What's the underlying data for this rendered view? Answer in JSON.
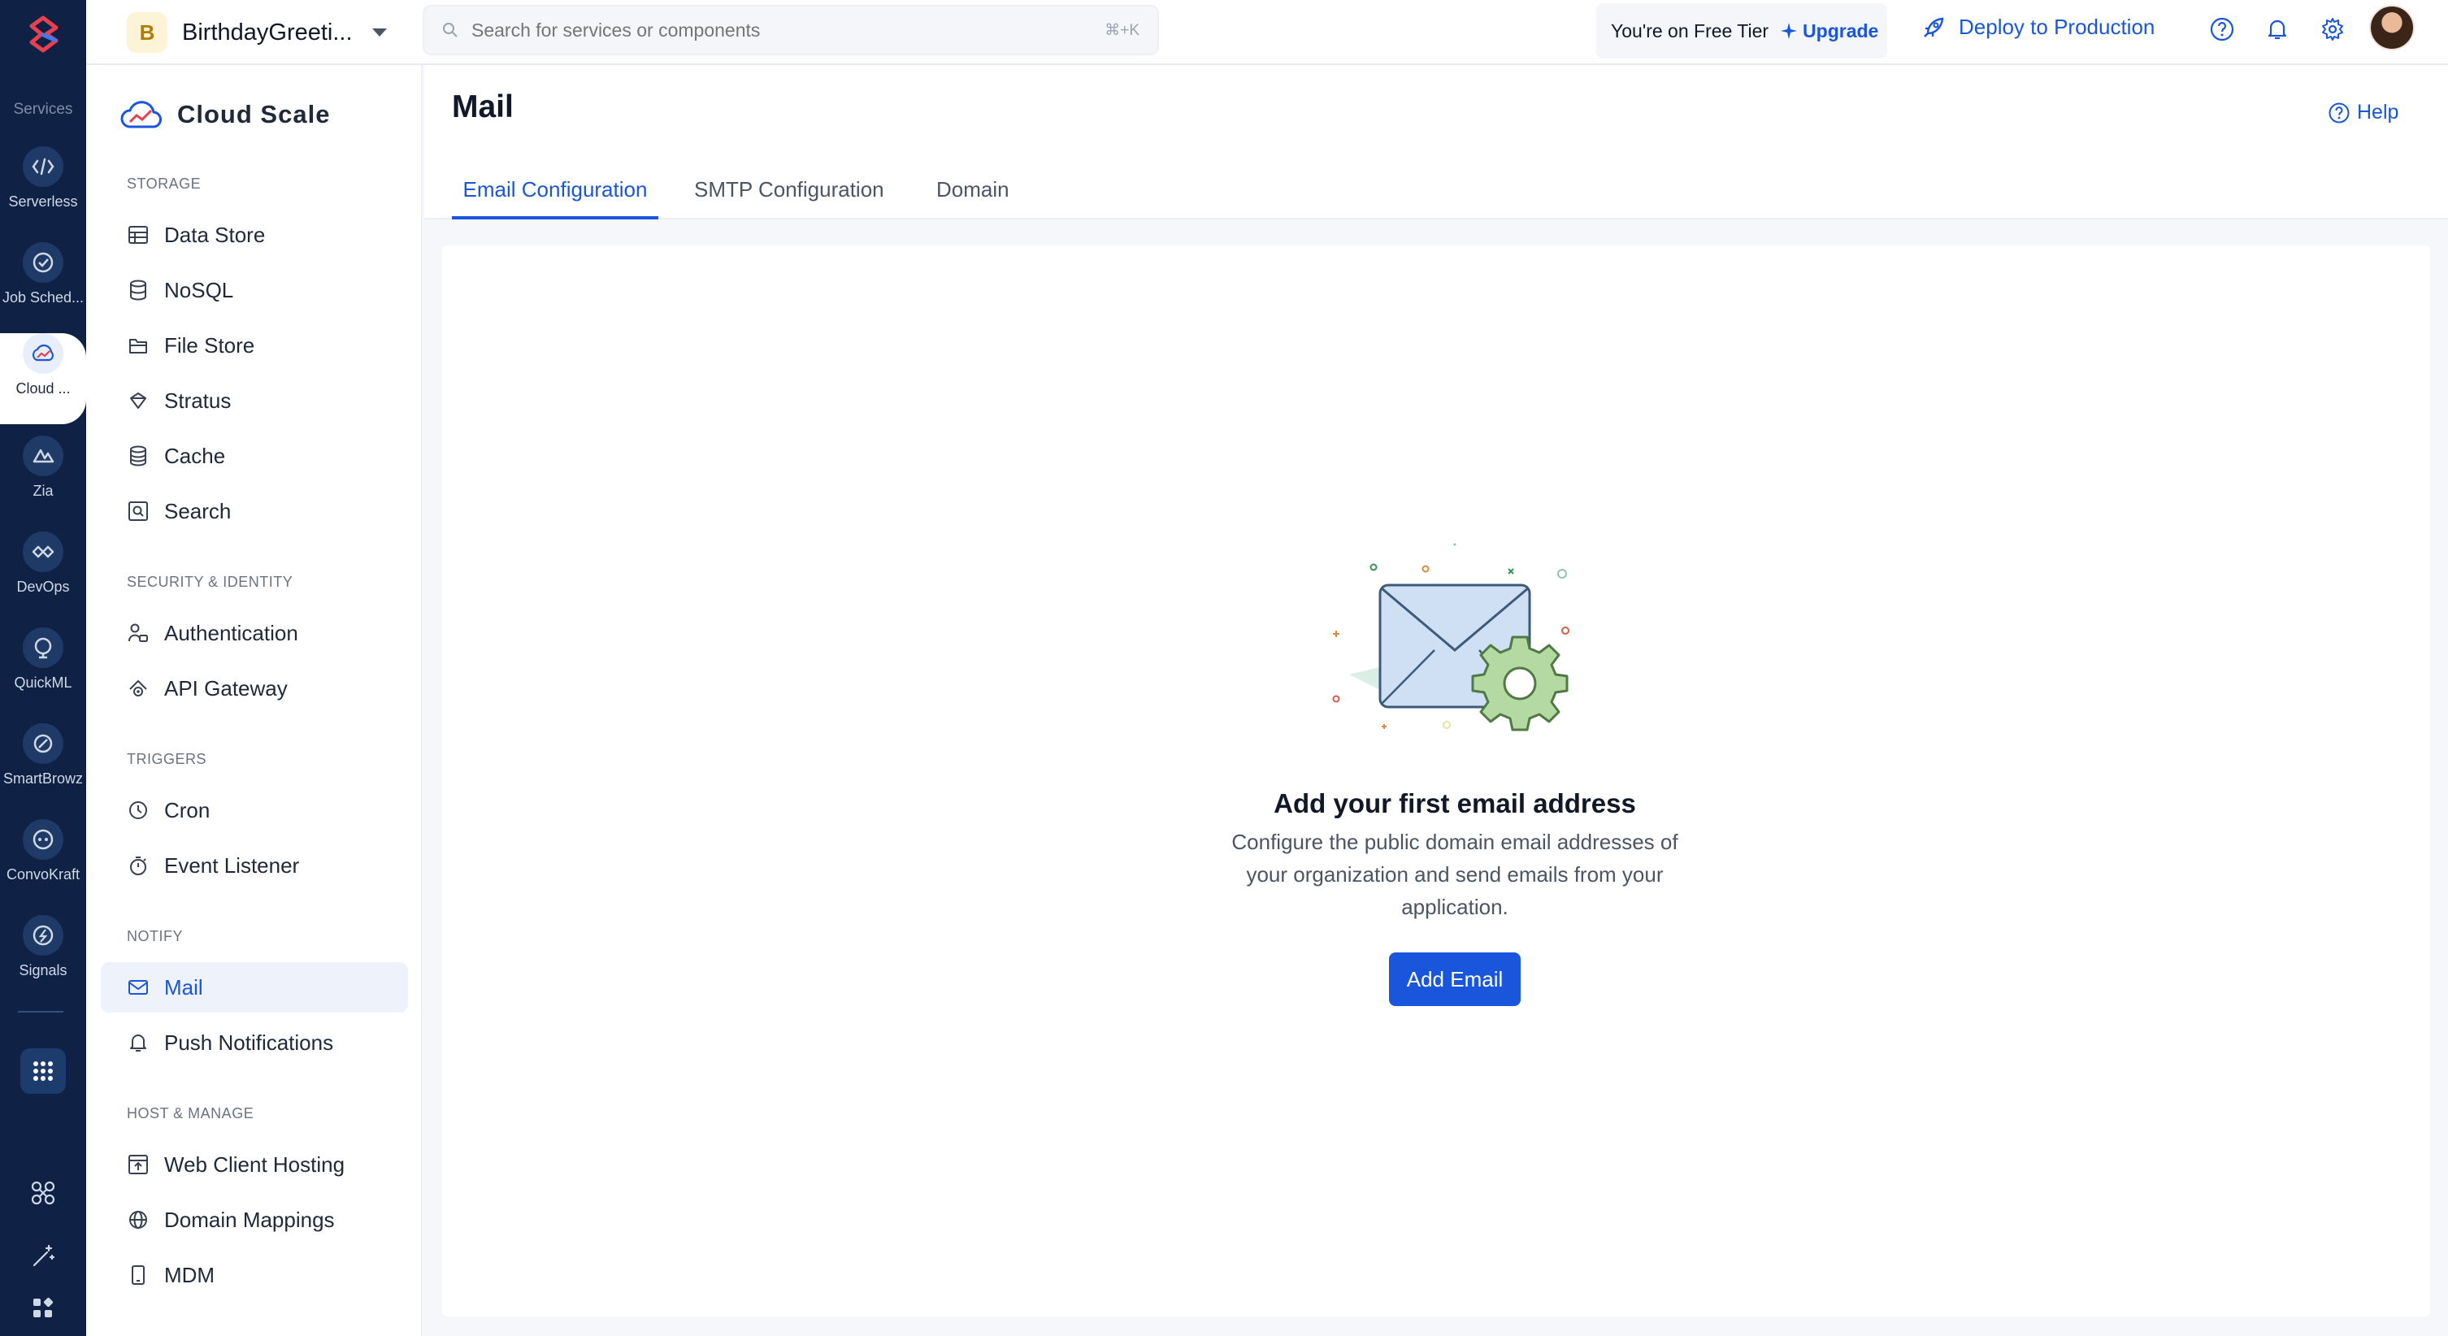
{
  "rail": {
    "section_label": "Services",
    "items": [
      {
        "label": "Serverless",
        "icon": "serverless-icon"
      },
      {
        "label": "Job Sched...",
        "icon": "job-scheduling-icon"
      },
      {
        "label": "Cloud ...",
        "icon": "cloud-scale-icon",
        "active": true
      },
      {
        "label": "Zia",
        "icon": "zia-icon"
      },
      {
        "label": "DevOps",
        "icon": "devops-icon"
      },
      {
        "label": "QuickML",
        "icon": "quickml-icon"
      },
      {
        "label": "SmartBrowz",
        "icon": "smartbrowz-icon"
      },
      {
        "label": "ConvoKraft",
        "icon": "convokraft-icon"
      },
      {
        "label": "Signals",
        "icon": "signals-icon"
      }
    ]
  },
  "topbar": {
    "project_initial": "B",
    "project_name": "BirthdayGreeti...",
    "search_placeholder": "Search for services or components",
    "search_shortcut": "⌘+K",
    "tier_text": "You're on Free Tier",
    "upgrade_label": "Upgrade",
    "deploy_label": "Deploy to Production"
  },
  "sidebar": {
    "title": "Cloud Scale",
    "categories": {
      "storage": "STORAGE",
      "security": "SECURITY & IDENTITY",
      "triggers": "TRIGGERS",
      "notify": "NOTIFY",
      "host": "HOST & MANAGE"
    },
    "items": {
      "data_store": "Data Store",
      "nosql": "NoSQL",
      "file_store": "File Store",
      "stratus": "Stratus",
      "cache": "Cache",
      "search": "Search",
      "authentication": "Authentication",
      "api_gateway": "API Gateway",
      "cron": "Cron",
      "event_listener": "Event Listener",
      "mail": "Mail",
      "push_notifications": "Push Notifications",
      "web_client_hosting": "Web Client Hosting",
      "domain_mappings": "Domain Mappings",
      "mdm": "MDM"
    }
  },
  "main": {
    "title": "Mail",
    "help_label": "Help",
    "tabs": [
      "Email Configuration",
      "SMTP Configuration",
      "Domain"
    ],
    "active_tab": "Email Configuration",
    "empty_state": {
      "heading": "Add your first email address",
      "description": "Configure the public domain email addresses of your organization and send emails from your application.",
      "button_label": "Add Email"
    }
  },
  "colors": {
    "accent": "#1a56db",
    "rail_bg": "#0f2245",
    "active_bg": "#eef2fb"
  }
}
